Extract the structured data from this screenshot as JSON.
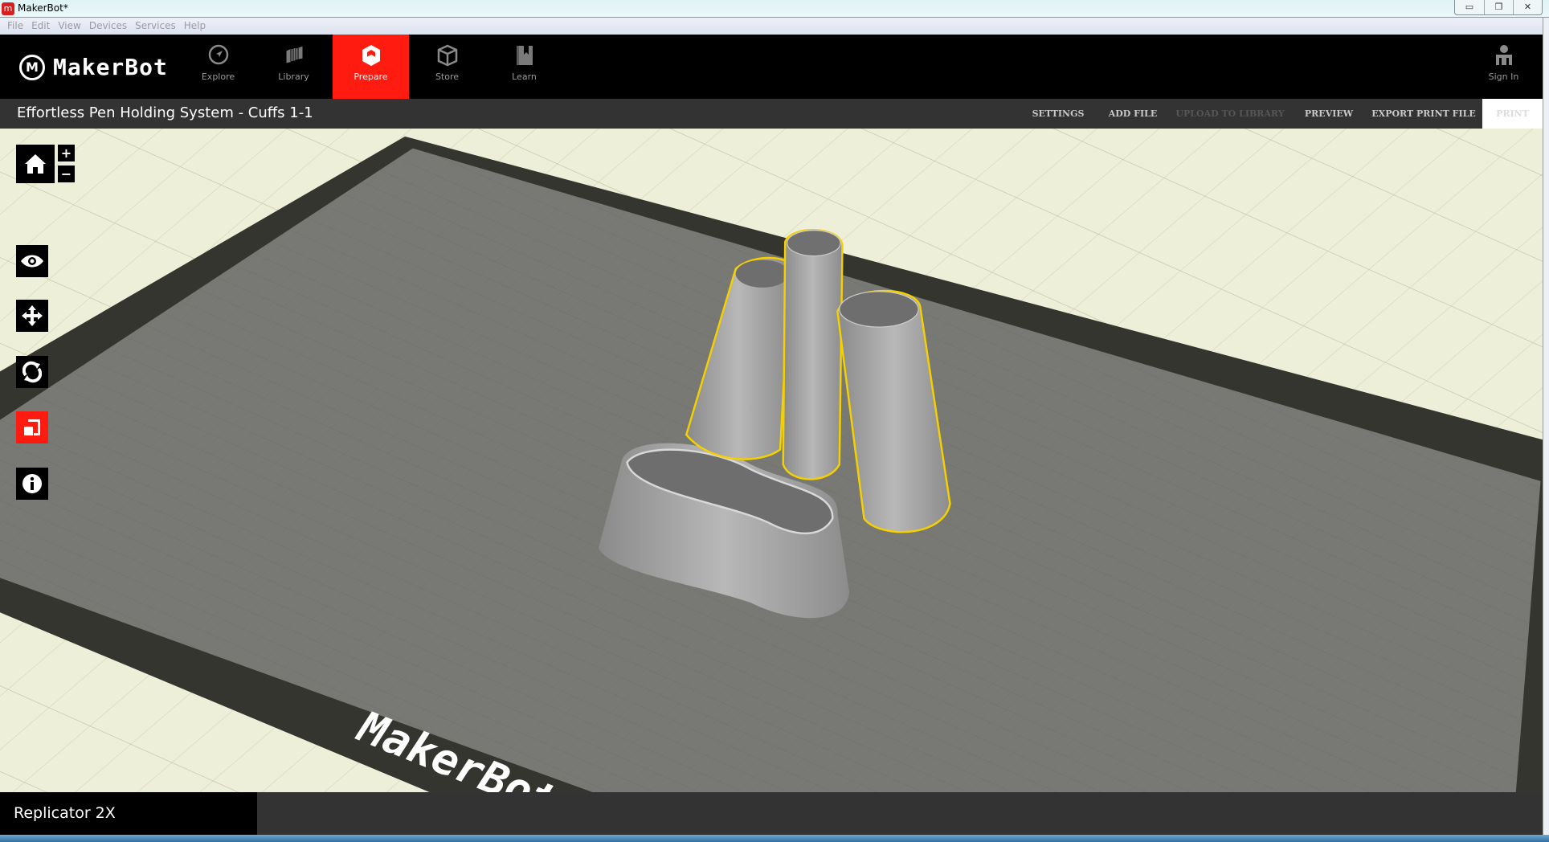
{
  "window": {
    "title": "MakerBot*",
    "app_icon": "makerbot-app-icon",
    "controls": [
      "minimize",
      "restore",
      "close"
    ]
  },
  "menu": [
    "File",
    "Edit",
    "View",
    "Devices",
    "Services",
    "Help"
  ],
  "nav": {
    "logo_text": "MakerBot",
    "items": [
      {
        "label": "Explore",
        "icon": "compass-icon"
      },
      {
        "label": "Library",
        "icon": "library-icon"
      },
      {
        "label": "Prepare",
        "icon": "prepare-icon",
        "active": true
      },
      {
        "label": "Store",
        "icon": "box-icon"
      },
      {
        "label": "Learn",
        "icon": "book-icon"
      }
    ],
    "sign_in": "Sign In"
  },
  "subbar": {
    "document_title": "Effortless Pen Holding System - Cuffs 1-1",
    "buttons": [
      {
        "label": "SETTINGS"
      },
      {
        "label": "ADD FILE"
      },
      {
        "label": "UPLOAD TO LIBRARY",
        "disabled": true
      },
      {
        "label": "PREVIEW"
      },
      {
        "label": "EXPORT PRINT FILE"
      }
    ],
    "print": "PRINT"
  },
  "viewport": {
    "plate_logo": "MakerBot",
    "selection_color": "#f5d000",
    "accent": "#ff1b10"
  },
  "toolbar": {
    "zoom_in": "+",
    "zoom_out": "−"
  },
  "bottom": {
    "printer": "Replicator 2X"
  }
}
